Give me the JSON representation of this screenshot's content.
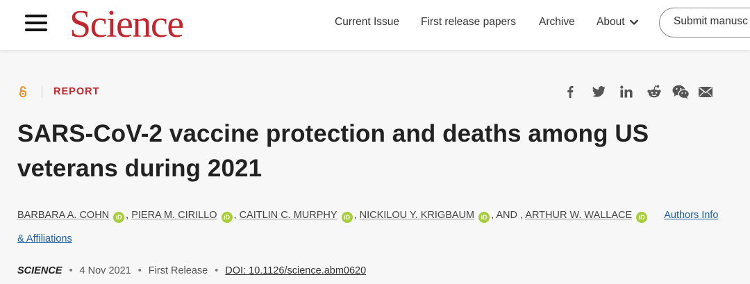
{
  "header": {
    "logo": "Science",
    "nav": [
      "Current Issue",
      "First release papers",
      "Archive",
      "About"
    ],
    "submit_label": "Submit manusc"
  },
  "article": {
    "type_label": "REPORT",
    "title": "SARS-CoV-2 vaccine protection and deaths among US veterans during 2021",
    "authors": [
      "BARBARA A. COHN",
      "PIERA M. CIRILLO",
      "CAITLIN C. MURPHY",
      "NICKILOU Y. KRIGBAUM",
      "ARTHUR W. WALLACE"
    ],
    "and_text": "AND",
    "authors_info_link": "Authors Info & Affiliations",
    "journal": "SCIENCE",
    "date": "4 Nov 2021",
    "release": "First Release",
    "doi": "DOI: 10.1126/science.abm0620"
  },
  "share_icons": [
    "facebook-icon",
    "twitter-icon",
    "linkedin-icon",
    "reddit-icon",
    "wechat-icon",
    "email-icon"
  ],
  "colors": {
    "brand_red": "#c1272d",
    "orcid_green": "#a6ce39",
    "link_blue": "#1f5fa8"
  }
}
